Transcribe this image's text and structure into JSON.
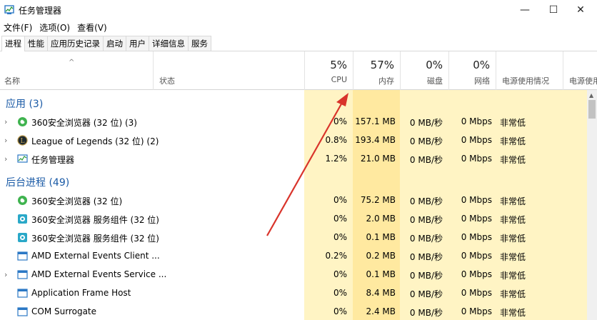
{
  "window": {
    "title": "任务管理器",
    "minimize_glyph": "—",
    "maximize_glyph": "☐",
    "close_glyph": "✕"
  },
  "menu": [
    "文件(F)",
    "选项(O)",
    "查看(V)"
  ],
  "tabs": [
    "进程",
    "性能",
    "应用历史记录",
    "启动",
    "用户",
    "详细信息",
    "服务"
  ],
  "header": {
    "sort_arrow": "^",
    "name": "名称",
    "status": "状态",
    "cpu_pct": "5%",
    "cpu": "CPU",
    "mem_pct": "57%",
    "mem": "内存",
    "disk_pct": "0%",
    "disk": "磁盘",
    "net_pct": "0%",
    "net": "网络",
    "power": "电源使用情况",
    "power_trend": "电源使用"
  },
  "groups": {
    "apps": "应用 (3)",
    "background": "后台进程 (49)"
  },
  "apps": [
    {
      "name": "360安全浏览器 (32 位) (3)",
      "cpu": "0%",
      "mem": "157.1 MB",
      "disk": "0 MB/秒",
      "net": "0 Mbps",
      "power": "非常低",
      "icon": "browser-360-icon"
    },
    {
      "name": "League of Legends (32 位) (2)",
      "cpu": "0.8%",
      "mem": "193.4 MB",
      "disk": "0 MB/秒",
      "net": "0 Mbps",
      "power": "非常低",
      "icon": "league-icon"
    },
    {
      "name": "任务管理器",
      "cpu": "1.2%",
      "mem": "21.0 MB",
      "disk": "0 MB/秒",
      "net": "0 Mbps",
      "power": "非常低",
      "icon": "task-manager-icon"
    }
  ],
  "background": [
    {
      "name": "360安全浏览器 (32 位)",
      "cpu": "0%",
      "mem": "75.2 MB",
      "disk": "0 MB/秒",
      "net": "0 Mbps",
      "power": "非常低",
      "icon": "browser-360-icon"
    },
    {
      "name": "360安全浏览器 服务组件 (32 位)",
      "cpu": "0%",
      "mem": "2.0 MB",
      "disk": "0 MB/秒",
      "net": "0 Mbps",
      "power": "非常低",
      "icon": "service-360-icon"
    },
    {
      "name": "360安全浏览器 服务组件 (32 位)",
      "cpu": "0%",
      "mem": "0.1 MB",
      "disk": "0 MB/秒",
      "net": "0 Mbps",
      "power": "非常低",
      "icon": "service-360-icon"
    },
    {
      "name": "AMD External Events Client ...",
      "cpu": "0.2%",
      "mem": "0.2 MB",
      "disk": "0 MB/秒",
      "net": "0 Mbps",
      "power": "非常低",
      "icon": "window-app-icon"
    },
    {
      "name": "AMD External Events Service ...",
      "cpu": "0%",
      "mem": "0.1 MB",
      "disk": "0 MB/秒",
      "net": "0 Mbps",
      "power": "非常低",
      "icon": "window-app-icon"
    },
    {
      "name": "Application Frame Host",
      "cpu": "0%",
      "mem": "8.4 MB",
      "disk": "0 MB/秒",
      "net": "0 Mbps",
      "power": "非常低",
      "icon": "window-app-icon"
    },
    {
      "name": "COM Surrogate",
      "cpu": "0%",
      "mem": "2.4 MB",
      "disk": "0 MB/秒",
      "net": "0 Mbps",
      "power": "非常低",
      "icon": "window-app-icon"
    }
  ],
  "colors": {
    "heat_light": "#fff4c4",
    "heat_mid": "#ffe9a0",
    "group_title": "#1a5aa6",
    "annotation_arrow": "#d9342b"
  }
}
